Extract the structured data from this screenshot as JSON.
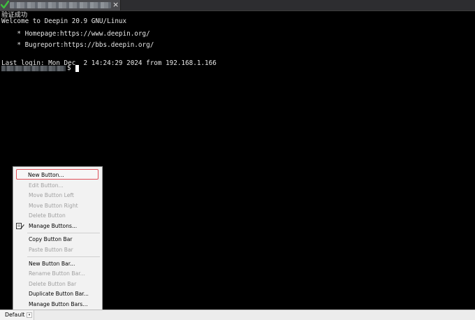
{
  "tab": {
    "status_icon": "checkmark-icon",
    "close_glyph": "×",
    "accent_color": "#3fbf3f"
  },
  "terminal": {
    "lines": [
      "验证成功",
      "Welcome to Deepin 20.9 GNU/Linux",
      "",
      "    * Homepage:https://www.deepin.org/",
      "",
      "    * Bugreport:https://bbs.deepin.org/",
      "",
      "",
      "Last login: Mon Dec  2 14:24:29 2024 from 192.168.1.166"
    ],
    "prompt_symbol": "$"
  },
  "context_menu": {
    "items": [
      {
        "label": "New Button...",
        "disabled": false
      },
      {
        "label": "Edit Button...",
        "disabled": true
      },
      {
        "label": "Move Button Left",
        "disabled": true
      },
      {
        "label": "Move Button Right",
        "disabled": true
      },
      {
        "label": "Delete Button",
        "disabled": true
      },
      {
        "label": "Manage Buttons...",
        "disabled": false
      },
      {
        "label": "Copy Button Bar",
        "disabled": false
      },
      {
        "label": "Paste Button Bar",
        "disabled": true
      },
      {
        "label": "New Button Bar...",
        "disabled": false
      },
      {
        "label": "Rename Button Bar...",
        "disabled": true
      },
      {
        "label": "Delete Button Bar",
        "disabled": true
      },
      {
        "label": "Duplicate Button Bar...",
        "disabled": false
      },
      {
        "label": "Manage Button Bars...",
        "disabled": false
      }
    ],
    "highlight_color": "#e0505a"
  },
  "bottom_bar": {
    "button_bar_name": "Default",
    "dropdown_glyph": "▾"
  }
}
